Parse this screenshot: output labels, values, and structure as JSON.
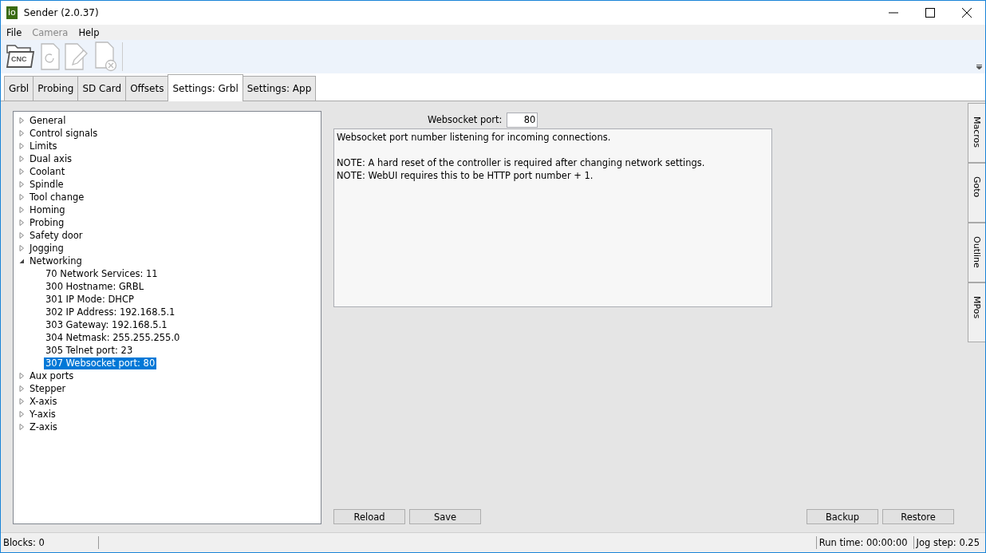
{
  "window": {
    "app_icon": "io",
    "title": "Sender (2.0.37)"
  },
  "menu": [
    {
      "label": "File",
      "disabled": false
    },
    {
      "label": "Camera",
      "disabled": true
    },
    {
      "label": "Help",
      "disabled": false
    }
  ],
  "toolbar": [
    {
      "kind": "open",
      "label": "CNC",
      "disabled": false
    },
    {
      "kind": "reload",
      "disabled": true
    },
    {
      "kind": "edit",
      "disabled": true
    },
    {
      "kind": "close",
      "disabled": true
    }
  ],
  "tabs": [
    {
      "label": "Grbl",
      "selected": false
    },
    {
      "label": "Probing",
      "selected": false
    },
    {
      "label": "SD Card",
      "selected": false
    },
    {
      "label": "Offsets",
      "selected": false
    },
    {
      "label": "Settings: Grbl",
      "selected": true
    },
    {
      "label": "Settings: App",
      "selected": false
    }
  ],
  "tree": [
    {
      "label": "General",
      "expanded": false
    },
    {
      "label": "Control signals",
      "expanded": false
    },
    {
      "label": "Limits",
      "expanded": false
    },
    {
      "label": "Dual axis",
      "expanded": false
    },
    {
      "label": "Coolant",
      "expanded": false
    },
    {
      "label": "Spindle",
      "expanded": false
    },
    {
      "label": "Tool change",
      "expanded": false
    },
    {
      "label": "Homing",
      "expanded": false
    },
    {
      "label": "Probing",
      "expanded": false
    },
    {
      "label": "Safety door",
      "expanded": false
    },
    {
      "label": "Jogging",
      "expanded": false
    },
    {
      "label": "Networking",
      "expanded": true,
      "children": [
        {
          "label": "70  Network Services: 11",
          "selected": false
        },
        {
          "label": "300  Hostname: GRBL",
          "selected": false
        },
        {
          "label": "301  IP Mode: DHCP",
          "selected": false
        },
        {
          "label": "302  IP Address: 192.168.5.1",
          "selected": false
        },
        {
          "label": "303  Gateway: 192.168.5.1",
          "selected": false
        },
        {
          "label": "304  Netmask: 255.255.255.0",
          "selected": false
        },
        {
          "label": "305  Telnet port: 23",
          "selected": false
        },
        {
          "label": "307  Websocket port: 80",
          "selected": true
        }
      ]
    },
    {
      "label": "Aux ports",
      "expanded": false
    },
    {
      "label": "Stepper",
      "expanded": false
    },
    {
      "label": "X-axis",
      "expanded": false
    },
    {
      "label": "Y-axis",
      "expanded": false
    },
    {
      "label": "Z-axis",
      "expanded": false
    }
  ],
  "setting": {
    "label": "Websocket port:",
    "value": "80",
    "description": [
      "Websocket port number listening for incoming connections."
    ],
    "notes": [
      "NOTE: A hard reset of the controller is required after changing network settings.",
      "NOTE: WebUI requires this to be HTTP port number + 1."
    ]
  },
  "buttons_left": [
    "Reload",
    "Save"
  ],
  "buttons_right": [
    "Backup",
    "Restore"
  ],
  "side_tabs": [
    "Macros",
    "Goto",
    "Outline",
    "MPos"
  ],
  "status_bar": {
    "blocks": "Blocks: 0",
    "run_time": "Run time: 00:00:00",
    "jog_step": "Jog step: 0.25"
  }
}
